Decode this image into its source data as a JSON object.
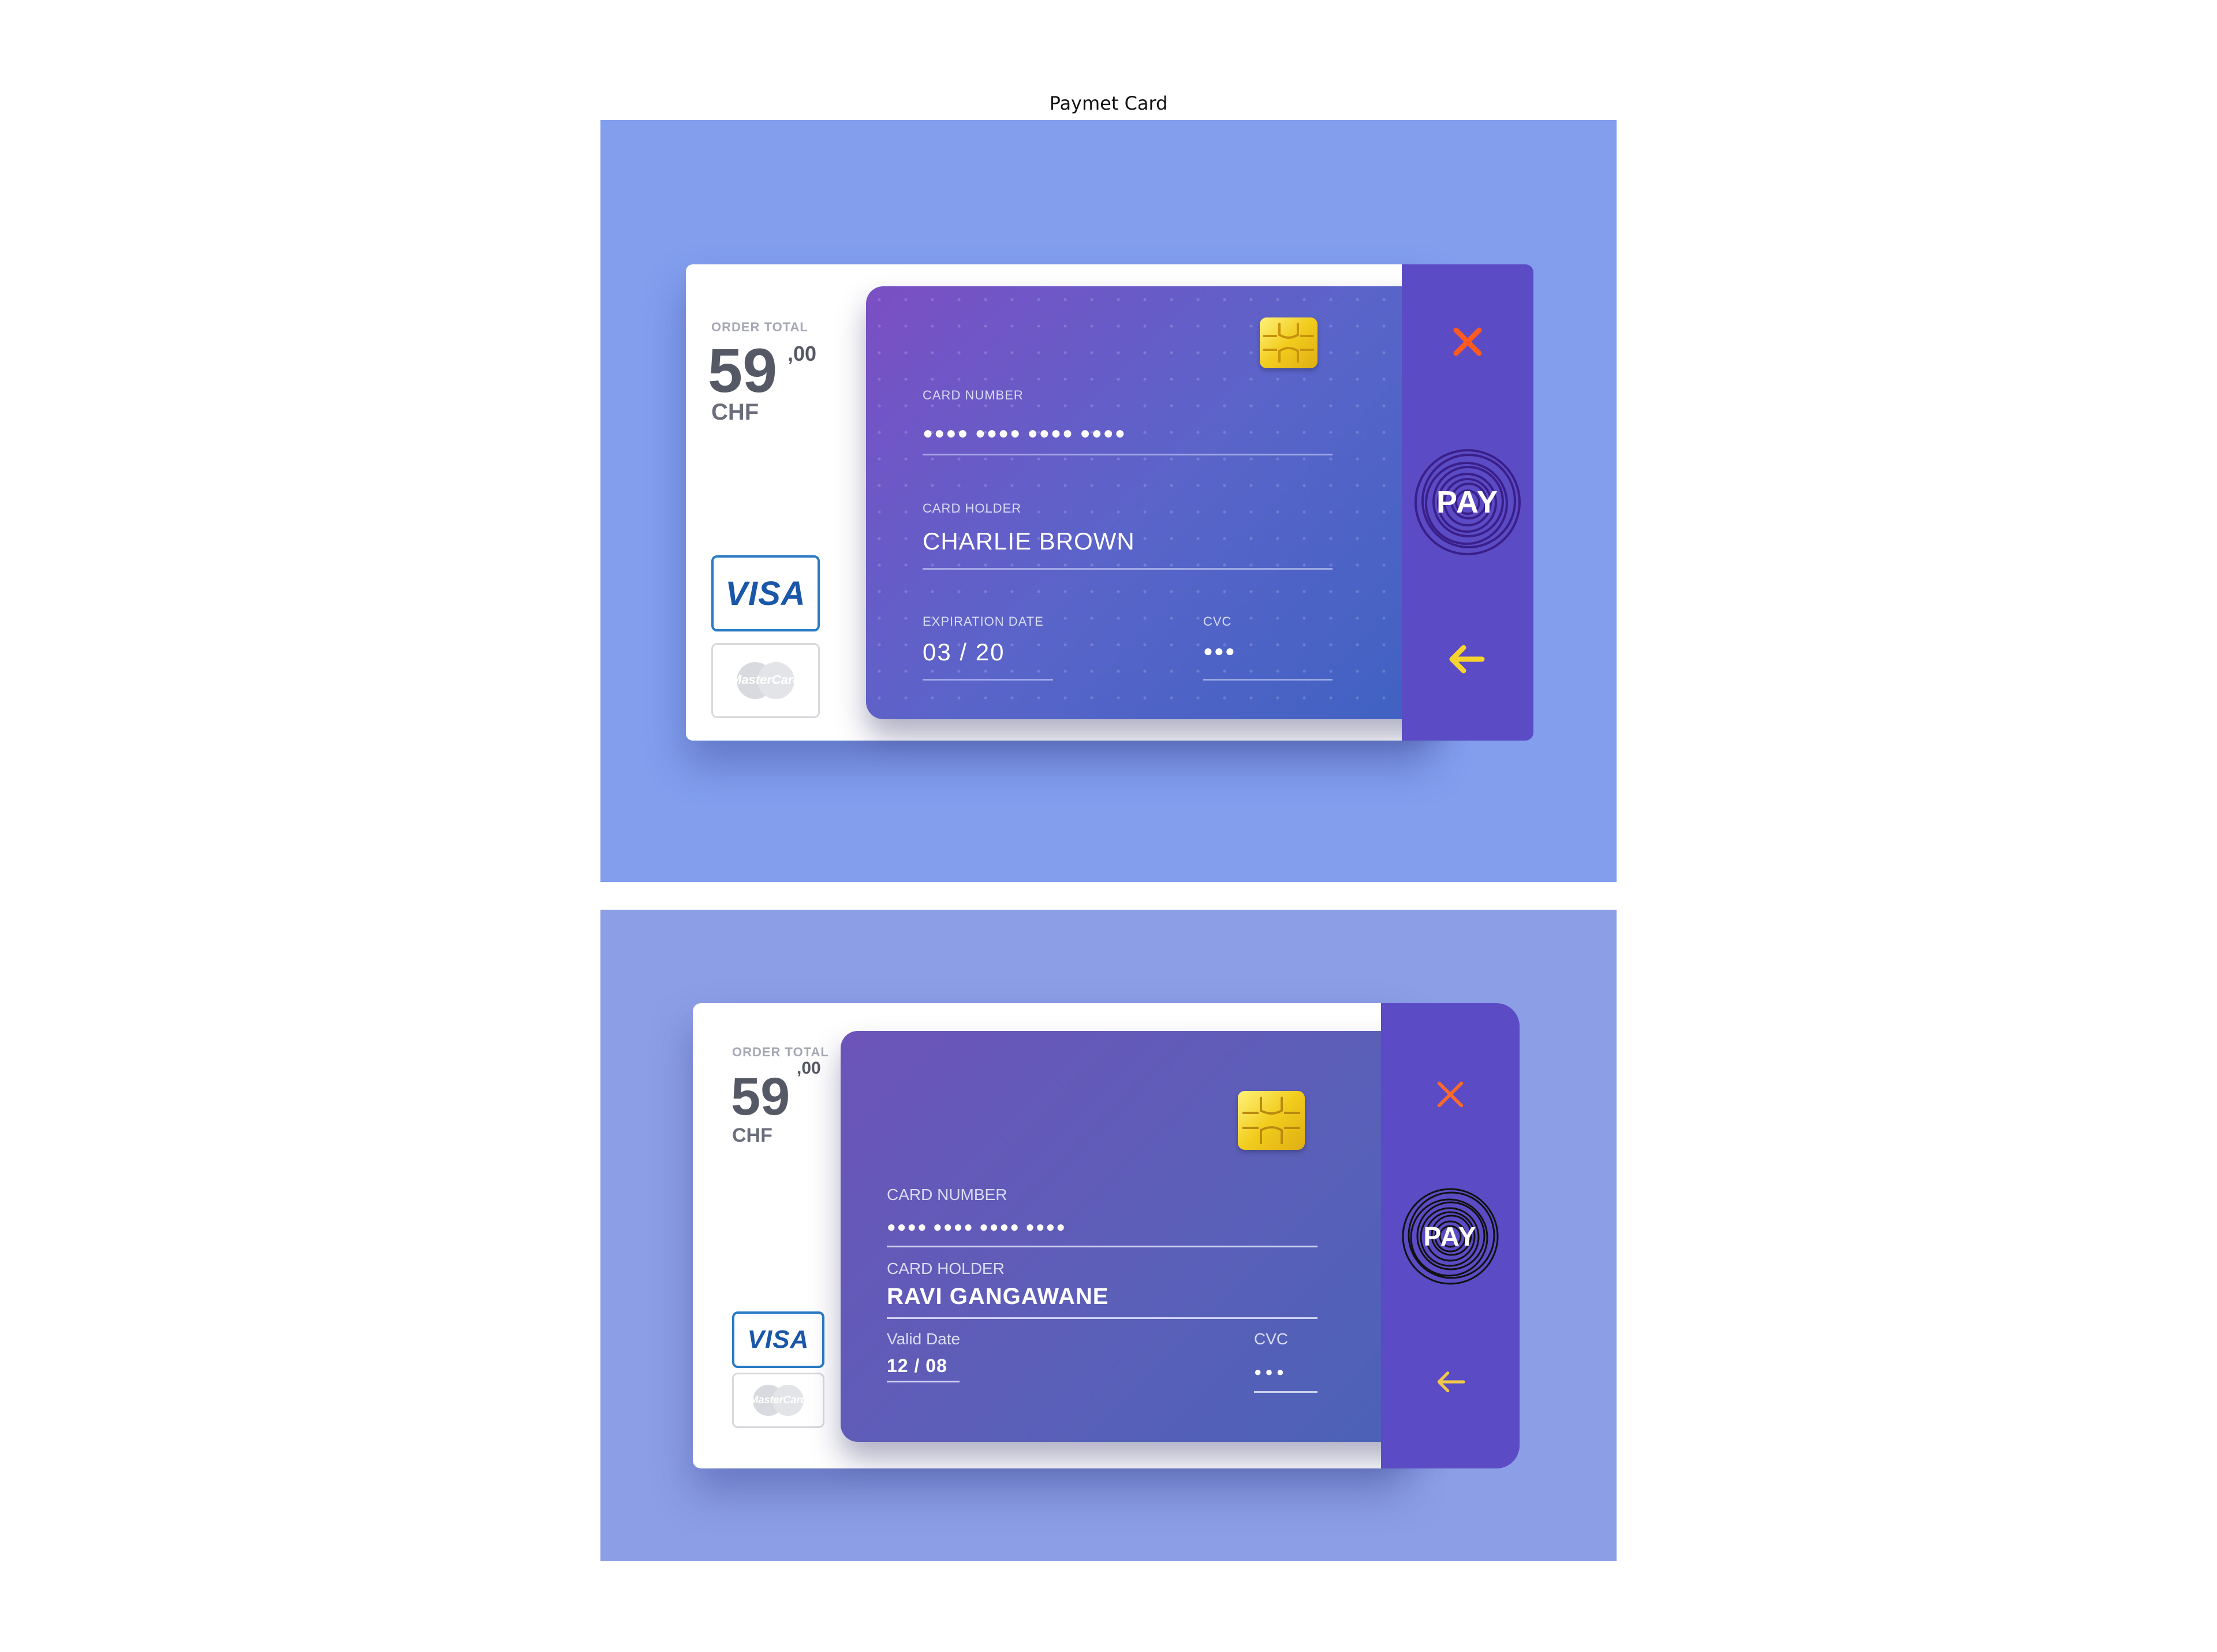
{
  "page": {
    "title": "Paymet Card"
  },
  "colors": {
    "accent": "#5b4bc4",
    "close": "#ff5a1f",
    "back": "#f6d32d",
    "panel1": "#829eed",
    "panel2": "#8c9ee6"
  },
  "variant1": {
    "order_label": "ORDER TOTAL",
    "amount_int": "59",
    "amount_dec": ",00",
    "currency": "CHF",
    "brands": {
      "visa": "VISA",
      "mastercard": "MasterCard"
    },
    "card_number_label": "CARD NUMBER",
    "card_number_value": "●●●●  ●●●●  ●●●●  ●●●●",
    "holder_label": "CARD HOLDER",
    "holder_value": "CHARLIE BROWN",
    "expiry_label": "EXPIRATION DATE",
    "expiry_value": "03  /  20",
    "cvc_label": "CVC",
    "cvc_value": "●●●",
    "pay_label": "PAY",
    "icons": [
      "close-icon",
      "fingerprint-icon",
      "back-arrow-icon",
      "chip-icon"
    ]
  },
  "variant2": {
    "order_label": "ORDER TOTAL",
    "amount_int": "59",
    "amount_dec": ",00",
    "currency": "CHF",
    "brands": {
      "visa": "VISA",
      "mastercard": "MasterCard"
    },
    "card_number_label": "CARD NUMBER",
    "card_number_value": "●●●●  ●●●●  ●●●●  ●●●●",
    "holder_label": "CARD HOLDER",
    "holder_value": "RAVI GANGAWANE",
    "expiry_label": "Valid Date",
    "expiry_value": "12 / 08",
    "cvc_label": "CVC",
    "cvc_value": "●  ●  ●",
    "pay_label": "PAY",
    "icons": [
      "close-icon",
      "fingerprint-icon",
      "back-arrow-icon",
      "chip-icon"
    ]
  }
}
